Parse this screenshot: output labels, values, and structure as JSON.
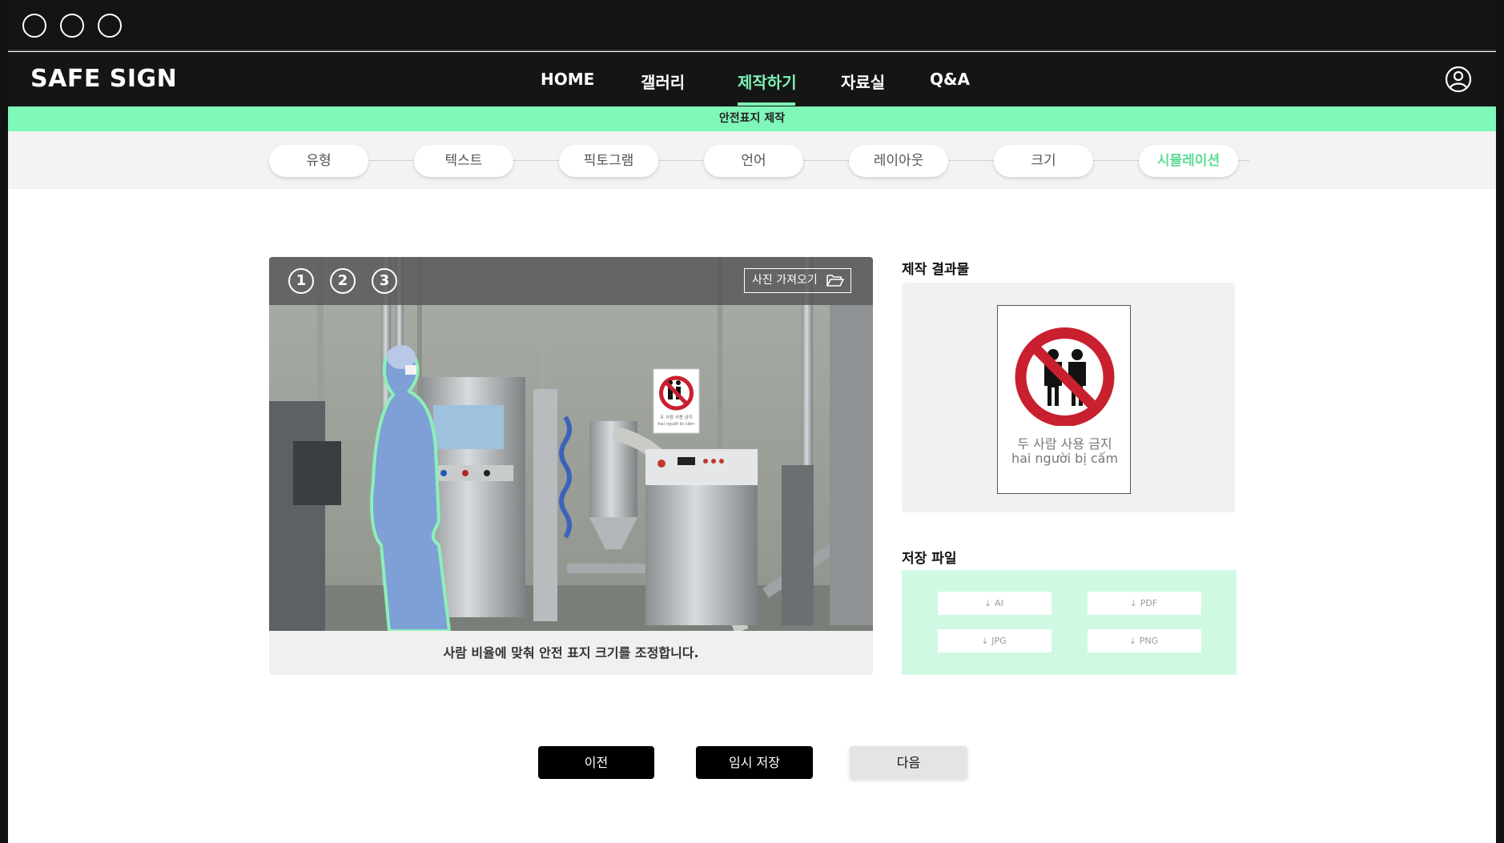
{
  "app": {
    "logo": "SAFE SIGN"
  },
  "nav": {
    "items": [
      {
        "label": "HOME"
      },
      {
        "label": "갤러리"
      },
      {
        "label": "제작하기",
        "active": true
      },
      {
        "label": "자료실"
      },
      {
        "label": "Q&A"
      }
    ]
  },
  "subbar": {
    "label": "안전표지 제작"
  },
  "steps": [
    {
      "label": "유형"
    },
    {
      "label": "텍스트"
    },
    {
      "label": "픽토그램"
    },
    {
      "label": "언어"
    },
    {
      "label": "레이아웃"
    },
    {
      "label": "크기"
    },
    {
      "label": "시뮬레이션",
      "active": true
    }
  ],
  "preview": {
    "numbers": [
      "1",
      "2",
      "3"
    ],
    "import_label": "사진 가져오기",
    "caption": "사람 비율에 맞춰 안전 표지 크기를 조정합니다.",
    "mini_sign": {
      "line1": "두 사람 사용 금지",
      "line2": "hai người bị cấm"
    }
  },
  "result": {
    "title": "제작 결과물",
    "sign_line1": "두 사람 사용 금지",
    "sign_line2": "hai người bị cấm"
  },
  "files": {
    "title": "저장 파일",
    "formats": [
      "AI",
      "PDF",
      "JPG",
      "PNG"
    ]
  },
  "buttons": {
    "prev": "이전",
    "save": "임시 저장",
    "next": "다음"
  },
  "colors": {
    "accent": "#7ff2b6",
    "prohibition_red": "#c8202f",
    "dark": "#151515"
  }
}
